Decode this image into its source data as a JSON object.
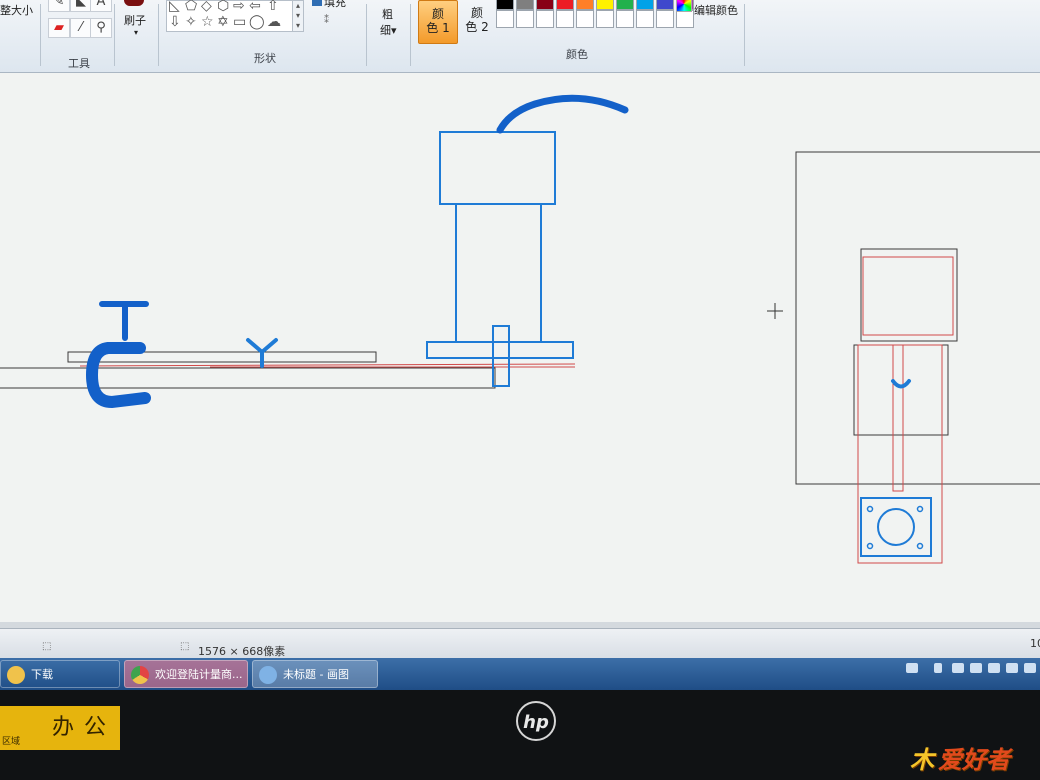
{
  "ribbon": {
    "resize_label": "重新调整大小",
    "resize_label_visible": "整大小",
    "tools_group": "工具",
    "brush_label": "刷子",
    "shapes_group": "形状",
    "fill_label": "填充",
    "size_label_line1": "粗",
    "size_label_line2": "细",
    "color1_line1": "颜",
    "color1_line2": "色 1",
    "color2_line1": "颜",
    "color2_line2": "色 2",
    "colors_group": "颜色",
    "edit_colors": "编辑颜色",
    "palette_row1": [
      "#000000",
      "#7f7f7f",
      "#880015",
      "#ed1c24",
      "#ff7f27",
      "#fff200",
      "#22b14c",
      "#00a2e8",
      "#3f48cc",
      "#a349a4"
    ],
    "palette_row2": [
      "#ffffff",
      "#ffffff",
      "#ffffff",
      "#ffffff",
      "#ffffff",
      "#ffffff",
      "#ffffff",
      "#ffffff",
      "#ffffff",
      "#ffffff"
    ]
  },
  "status": {
    "dimensions": "1576 × 668像素",
    "zoom": "10"
  },
  "taskbar": {
    "items": [
      {
        "label": "下载",
        "color": "#f0c24b"
      },
      {
        "label": "欢迎登陆计量商...",
        "color": "#e24444"
      },
      {
        "label": "未标题 - 画图",
        "color": "#7fb2e5"
      }
    ]
  },
  "bezel": {
    "sticker_text": "办公",
    "sticker_small": "区域",
    "brand": "hp"
  },
  "watermark": {
    "text": "爱好者"
  },
  "colors": {
    "drawing_blue": "#1f7bd6",
    "marker_blue": "#1360c9",
    "outline_red": "#d14a4a",
    "outline_dark": "#3a3a3a"
  }
}
